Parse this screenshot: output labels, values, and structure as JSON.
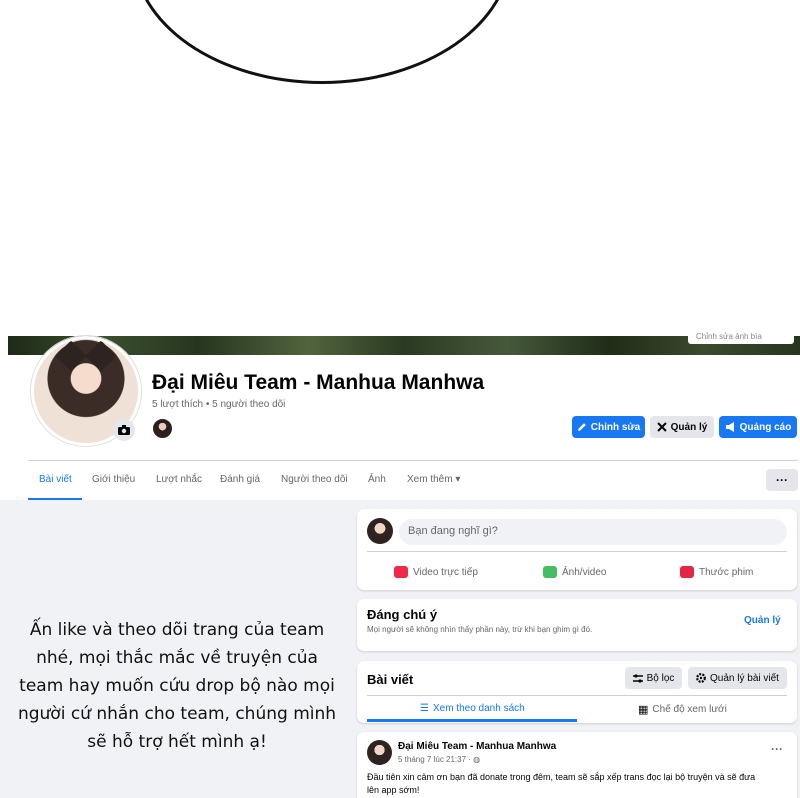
{
  "cover": {
    "edit_label": "Chỉnh sửa ảnh bìa"
  },
  "profile": {
    "name": "Đại Miêu Team - Manhua Manhwa",
    "stats": "5 lượt thích • 5 người theo dõi"
  },
  "actions": {
    "edit": "Chỉnh sửa",
    "manage": "Quản lý",
    "ads": "Quảng cáo"
  },
  "tabs": [
    {
      "label": "Bài viết"
    },
    {
      "label": "Giới thiệu"
    },
    {
      "label": "Lượt nhắc"
    },
    {
      "label": "Đánh giá"
    },
    {
      "label": "Người theo dõi"
    },
    {
      "label": "Ảnh"
    },
    {
      "label": "Xem thêm ▾"
    }
  ],
  "more_dots": "···",
  "promo": {
    "lines": [
      "Ấn like và theo dõi trang của team",
      "nhé, mọi thắc mắc về truyện của",
      "team hay muốn cứu drop bộ nào mọi",
      "người cứ nhắn cho team, chúng mình",
      "sẽ hỗ trợ hết mình ạ!"
    ]
  },
  "composer": {
    "placeholder": "Bạn đang nghĩ gì?",
    "live": "Video trực tiếp",
    "photo": "Ảnh/video",
    "reel": "Thước phim"
  },
  "featured": {
    "title": "Đáng chú ý",
    "desc": "Mọi người sẽ không nhìn thấy phần này, trừ khi bạn ghim gì đó.",
    "manage": "Quản lý"
  },
  "posts_header": {
    "title": "Bài viết",
    "filter": "Bộ lọc",
    "manage_posts": "Quản lý bài viết",
    "list_view": "Xem theo danh sách",
    "grid_view": "Chế độ xem lưới"
  },
  "post": {
    "author": "Đại Miêu Team - Manhua Manhwa",
    "time": "5 tháng 7 lúc 21:37 · ◍",
    "text_line1": "Đầu tiên xin cảm ơn bạn đã donate trong đêm, team sẽ sắp xếp trans đọc lại bộ truyện và sẽ đưa",
    "text_line2": "lên app sớm!",
    "menu": "···"
  },
  "colors": {
    "accent": "#1877f2",
    "bg_gray": "#f0f2f5",
    "button_gray": "#e4e6eb"
  }
}
